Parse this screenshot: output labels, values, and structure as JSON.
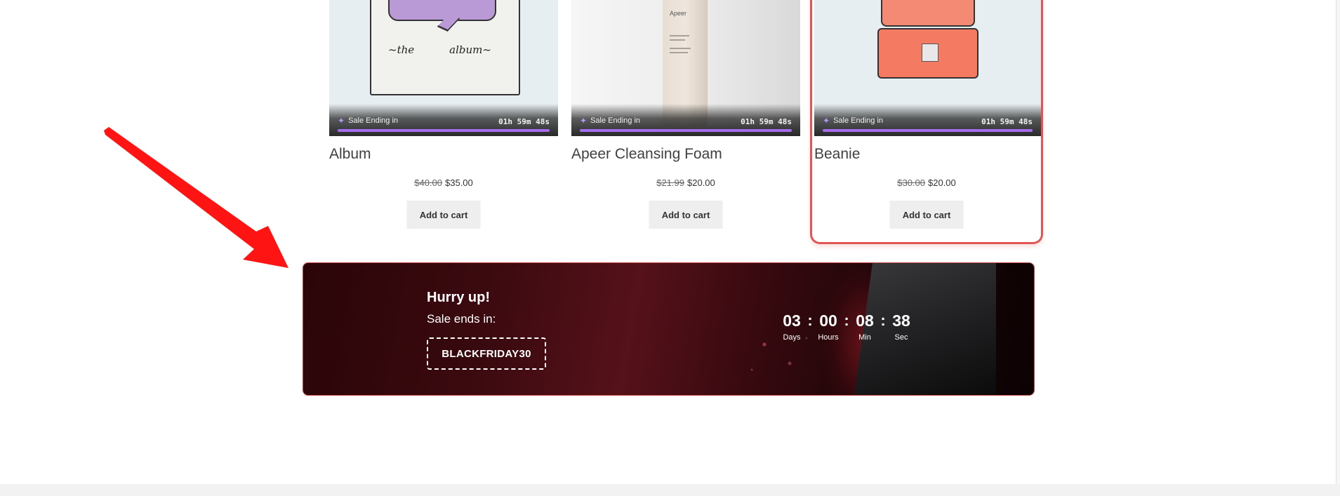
{
  "products": [
    {
      "name": "Album",
      "old_price": "$40.00",
      "new_price": "$35.00",
      "cart_label": "Add to cart",
      "sale_label": "Sale Ending in",
      "sale_time": "01h 59m 48s",
      "poster_text": [
        "~the",
        "album~"
      ]
    },
    {
      "name": "Apeer Cleansing Foam",
      "old_price": "$21.99",
      "new_price": "$20.00",
      "cart_label": "Add to cart",
      "sale_label": "Sale Ending in",
      "sale_time": "01h 59m 48s",
      "bottle_brand": "Apeer"
    },
    {
      "name": "Beanie",
      "old_price": "$30.00",
      "new_price": "$20.00",
      "cart_label": "Add to cart",
      "sale_label": "Sale Ending in",
      "sale_time": "01h 59m 48s"
    }
  ],
  "banner": {
    "heading": "Hurry up!",
    "subheading": "Sale ends in:",
    "coupon_code": "BLACKFRIDAY30",
    "countdown": [
      {
        "value": "03",
        "label": "Days"
      },
      {
        "value": "00",
        "label": "Hours"
      },
      {
        "value": "08",
        "label": "Min"
      },
      {
        "value": "38",
        "label": "Sec"
      }
    ],
    "separator": ":"
  },
  "colors": {
    "sale_progress": "#a56cf0",
    "highlight_border": "#e05555",
    "arrow": "#ff1414",
    "banner_dark": "#2a0508"
  }
}
